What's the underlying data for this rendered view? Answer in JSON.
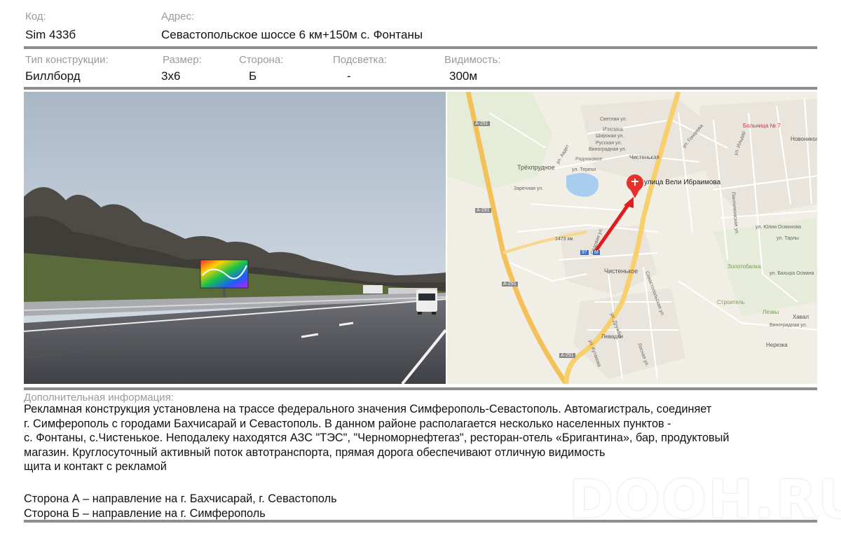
{
  "header": {
    "code_label": "Код:",
    "code_value": "Sim 433б",
    "address_label": "Адрес:",
    "address_value": "Севастопольское шоссе 6 км+150м  с. Фонтаны"
  },
  "specs": {
    "type_label": "Тип конструкции:",
    "type_value": "Биллборд",
    "size_label": "Размер:",
    "size_value": "3х6",
    "side_label": "Сторона:",
    "side_value": "Б",
    "light_label": "Подсветка:",
    "light_value": "-",
    "visibility_label": "Видимость:",
    "visibility_value": "300м"
  },
  "map": {
    "pin_label": "улица Вели Ибраимова",
    "places": {
      "trekhprudnoe": "Трёхпрудное",
      "chistenkoe": "Чистенькое",
      "chistenkaya": "Чистенькая",
      "levadki": "Левадки",
      "novonikolaevka": "Новоникол",
      "hospital": "Больница № 7",
      "zolotobalka": "Золотобалка",
      "stroitel": "Строитель",
      "lezvy": "Лезвы",
      "khaval": "Хавал",
      "nerezka": "Нерезка",
      "izyumka": "Изюмка",
      "grushevka": "Рядниковое"
    },
    "roads": {
      "a291_a": "А-291",
      "a291_b": "А-291",
      "a291_c": "А-291",
      "a291_d": "А-291",
      "km1473": "1473 км",
      "shield_a": "97",
      "shield_b": "М"
    },
    "streets": {
      "s1": "Светлая ул.",
      "s2": "Широкая ул.",
      "s3": "Русская ул.",
      "s4": "Виноградная ул.",
      "s5": "ул. Терехи",
      "s6": "ул. Авдет",
      "s7": "Заречная ул.",
      "s8": "Садовая ул.",
      "s9": "Севастопольская ул.",
      "s10": "ул. Дружбы",
      "s11": "ул. Кутакова",
      "s12": "Лесная ул.",
      "s13": "Пантелеевская ул.",
      "s14": "ул. Юлии Осмонова",
      "s15": "ул. Бахыра Османа",
      "s16": "Виноградная ул.",
      "s17": "ул. Тарлы",
      "s18": "ул. Ильдар",
      "s19": "ул. Гонорова"
    }
  },
  "info": {
    "label": "Дополнительная информация:",
    "lines": [
      "Рекламная конструкция установлена на трассе федерального значения Симферополь-Севастополь. Автомагистраль, соединяет",
      "г. Симферополь  с городами Бахчисарай и Севастополь. В данном районе располагается несколько населенных пунктов -",
      "с. Фонтаны, с.Чистенькое. Неподалеку находятся АЗС \"ТЭС\", \"Черноморнефтегаз\", ресторан-отель «Бригантина», бар, продуктовый",
      "магазин. Круглосуточный активный поток автотранспорта, прямая дорога обеспечивают отличную видимость",
      "щита и контакт с рекламой"
    ],
    "side_a": "Сторона А – направление на г. Бахчисарай, г. Севастополь",
    "side_b": "Сторона Б – направление на г. Симферополь"
  },
  "watermark": "DOOH.RU",
  "colors": {
    "rule": "#8e8e8e",
    "label": "#9a9a9a",
    "pin": "#e8312a",
    "arrow": "#e01c1c",
    "highway": "#f7c95a"
  }
}
